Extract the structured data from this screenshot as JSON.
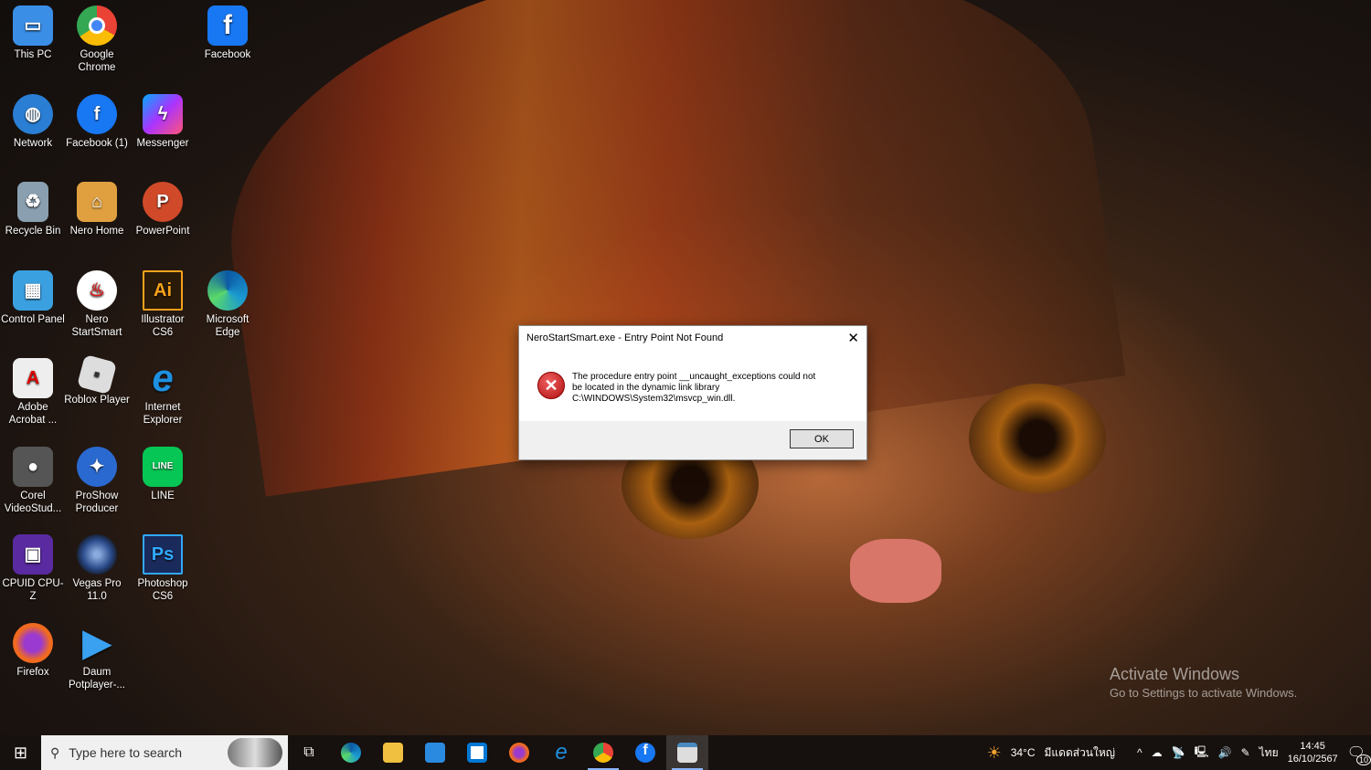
{
  "desktop": {
    "icons": [
      {
        "label": "This PC",
        "icon": "this-pc-icon",
        "color": "#3a8ee6"
      },
      {
        "label": "Network",
        "icon": "network-icon",
        "color": "#2a7fd4"
      },
      {
        "label": "Recycle Bin",
        "icon": "recycle-bin-icon",
        "color": "#8aa0b0"
      },
      {
        "label": "Control Panel",
        "icon": "control-panel-icon",
        "color": "#3aa0e0"
      },
      {
        "label": "Adobe Acrobat ...",
        "icon": "adobe-acrobat-icon",
        "color": "#e8e8e8"
      },
      {
        "label": "Corel VideoStud...",
        "icon": "corel-videostudio-icon",
        "color": "#555"
      },
      {
        "label": "CPUID CPU-Z",
        "icon": "cpuz-icon",
        "color": "#5a2aa0"
      },
      {
        "label": "Firefox",
        "icon": "firefox-icon",
        "color": "#f06a20"
      },
      {
        "label": "Google Chrome",
        "icon": "chrome-icon",
        "color": "#34a853"
      },
      {
        "label": "Facebook (1)",
        "icon": "facebook-icon",
        "color": "#1877f2"
      },
      {
        "label": "Nero Home",
        "icon": "nero-home-icon",
        "color": "#e0a040"
      },
      {
        "label": "Nero StartSmart",
        "icon": "nero-startsmart-icon",
        "color": "#d02020"
      },
      {
        "label": "Roblox Player",
        "icon": "roblox-icon",
        "color": "#ddd"
      },
      {
        "label": "ProShow Producer",
        "icon": "proshow-icon",
        "color": "#2a6ad0"
      },
      {
        "label": "Vegas Pro 11.0",
        "icon": "vegas-pro-icon",
        "color": "#2a4a8a"
      },
      {
        "label": "Daum Potplayer-...",
        "icon": "potplayer-icon",
        "color": "#3aa0f0"
      },
      {
        "label": "Messenger",
        "icon": "messenger-icon",
        "color": "#5a6af0"
      },
      {
        "label": "PowerPoint",
        "icon": "powerpoint-icon",
        "color": "#d04a2a"
      },
      {
        "label": "Illustrator CS6",
        "icon": "illustrator-icon",
        "color": "#2a1a08"
      },
      {
        "label": "Internet Explorer",
        "icon": "internet-explorer-icon",
        "color": "#1e90e0"
      },
      {
        "label": "LINE",
        "icon": "line-icon",
        "color": "#06c755"
      },
      {
        "label": "Photoshop CS6",
        "icon": "photoshop-icon",
        "color": "#1a2a5a"
      },
      {
        "label": "Facebook",
        "icon": "facebook-icon",
        "color": "#1877f2"
      },
      {
        "label": "Microsoft Edge",
        "icon": "edge-icon",
        "color": "#1a9ad0"
      }
    ],
    "glyphs": {
      "fb": "f",
      "ai": "Ai",
      "ps": "Ps",
      "p": "P",
      "line": "LINE",
      "e": "e"
    }
  },
  "dialog": {
    "title": "NeroStartSmart.exe - Entry Point Not Found",
    "line1": "The procedure entry point __uncaught_exceptions could not",
    "line2": "be located in the dynamic link library",
    "line3": "C:\\WINDOWS\\System32\\msvcp_win.dll.",
    "ok": "OK",
    "close": "✕",
    "error_glyph": "✕"
  },
  "watermark": {
    "title": "Activate Windows",
    "subtitle": "Go to Settings to activate Windows."
  },
  "taskbar": {
    "search_placeholder": "Type here to search",
    "weather_temp": "34°C",
    "weather_text": "มีแดดส่วนใหญ่",
    "language": "ไทย",
    "time": "14:45",
    "date": "16/10/2567",
    "notifications": "10"
  }
}
